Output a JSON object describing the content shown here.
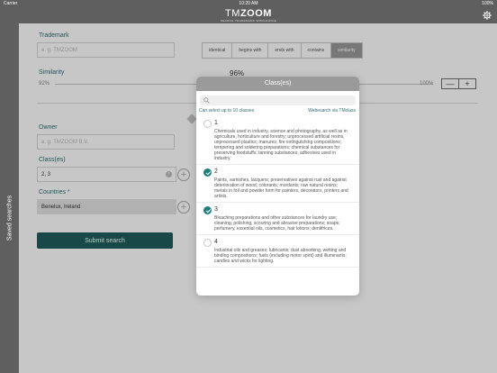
{
  "status": {
    "carrier": "Carrier",
    "time": "10:20 AM",
    "battery": "100%"
  },
  "app": {
    "brand_light": "TM",
    "brand_bold": "ZOOM",
    "tagline": "SEARCH TRADEMARK WORLDWIDE"
  },
  "sidebar": {
    "saved_searches": "Saved searches"
  },
  "form": {
    "trademark_label": "Trademark",
    "trademark_placeholder": "e. g. TMZOOM",
    "match_modes": [
      "identical",
      "begins with",
      "ends with",
      "contains",
      "similarity"
    ],
    "active_mode": "similarity",
    "similarity_label": "Similarity",
    "similarity_value": "96%",
    "similarity_min": "92%",
    "similarity_max": "100%",
    "stepper_minus": "—",
    "stepper_plus": "+",
    "owner_label": "Owner",
    "owner_placeholder": "e. g. TMZOOM B.V.",
    "classes_label": "Class(es)",
    "classes_value": "2, 3",
    "countries_label": "Countries *",
    "countries_value": "Benelux, Ireland",
    "submit_label": "Submit search"
  },
  "popover": {
    "title": "Class(es)",
    "info_left": "Can select up to 10 classes",
    "info_right": "Webesarch via TMclass",
    "items": [
      {
        "number": "1",
        "checked": false,
        "description": "Chemicals used in industry, science and photography, as well as in agriculture, horticulture and forestry; unprocessed artificial resins, unprocessed plastics; manures; fire extinguishing compositions; tempering and soldering preparations; chemical substances for preserving foodstuffs; tanning substances; adhesives used in industry."
      },
      {
        "number": "2",
        "checked": true,
        "description": "Paints, varnishes, lacquers; preservatives against rust and against deterioration of wood; colorants; mordants; raw natural resins; metals in foil and powder form for painters, decorators, printers and artists."
      },
      {
        "number": "3",
        "checked": true,
        "description": "Bleaching preparations and other substances for laundry use; cleaning, polishing, scouring and abrasive preparations; soaps; perfumery, essential oils, cosmetics, hair lotions; dentifrices."
      },
      {
        "number": "4",
        "checked": false,
        "description": "Industrial oils and greases; lubricants; dust absorbing, wetting and binding compositions; fuels (including motor spirit) and illuminants; candles and wicks for lighting."
      }
    ]
  }
}
